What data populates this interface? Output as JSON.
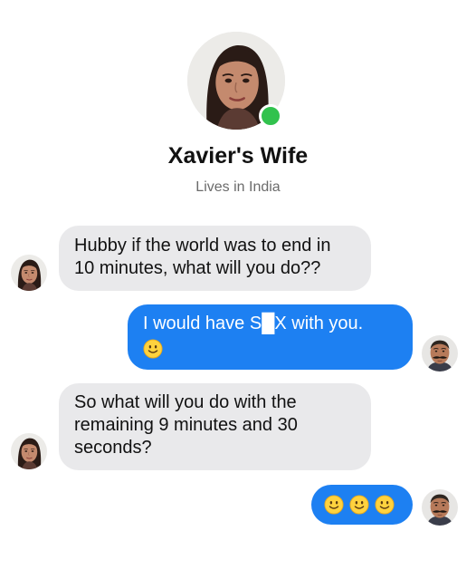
{
  "profile": {
    "name": "Xavier's Wife",
    "subtitle": "Lives in India",
    "online_status_color": "#31c24d",
    "avatar_icon": "woman-avatar"
  },
  "messages": [
    {
      "sender": "wife",
      "text": "Hubby if the world was to end in\n10 minutes, what will you do??"
    },
    {
      "sender": "husband",
      "text": "I would have S█X with you.",
      "emoji": [
        "slightly-smiling-face"
      ]
    },
    {
      "sender": "wife",
      "text": "So what will you do with the\nremaining 9 minutes and 30\nseconds?"
    },
    {
      "sender": "husband",
      "text": "",
      "emoji": [
        "slightly-smiling-face",
        "slightly-smiling-face",
        "slightly-smiling-face"
      ]
    }
  ],
  "colors": {
    "incoming_bubble": "#e9e9eb",
    "outgoing_bubble": "#1d80f2",
    "outgoing_text": "#ffffff"
  }
}
